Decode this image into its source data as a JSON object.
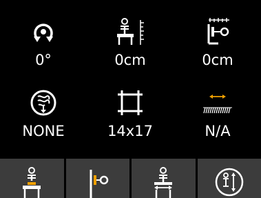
{
  "status_grid": {
    "rotation": {
      "value": "0°",
      "icon": "rotation-icon"
    },
    "height": {
      "value": "0cm",
      "icon": "height-position-icon"
    },
    "distance": {
      "value": "0cm",
      "icon": "tube-distance-icon"
    },
    "grid": {
      "value": "NONE",
      "icon": "anti-scatter-grid-icon"
    },
    "cassette_size": {
      "value": "14x17",
      "icon": "cassette-size-icon"
    },
    "grid_line": {
      "value": "N/A",
      "icon": "grid-lines-icon"
    }
  },
  "bottom_bar": [
    {
      "icon": "table-position-icon"
    },
    {
      "icon": "wall-stand-icon"
    },
    {
      "icon": "table-center-icon"
    },
    {
      "icon": "auto-tracking-icon"
    }
  ],
  "colors": {
    "background": "#000000",
    "text": "#ffffff",
    "accent": "#f0a000",
    "button": "#3c3c3c"
  }
}
